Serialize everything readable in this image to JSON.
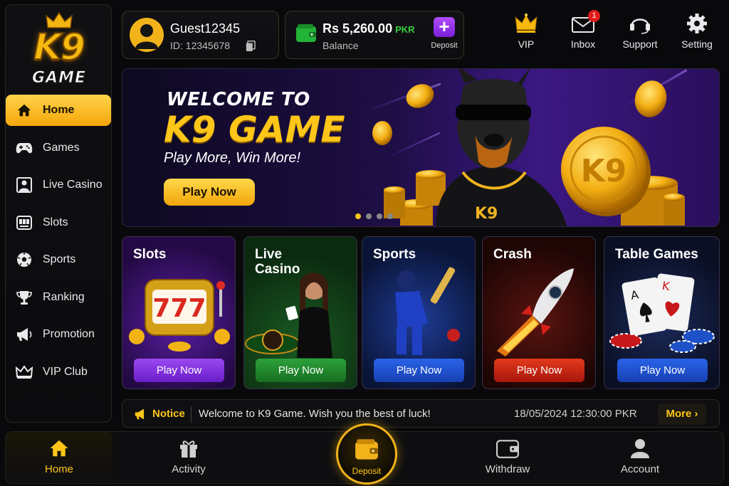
{
  "brand": {
    "logo_top": "K9",
    "logo_bottom": "GAME"
  },
  "sidebar": {
    "items": [
      {
        "label": "Home",
        "icon": "home-icon",
        "active": true
      },
      {
        "label": "Games",
        "icon": "gamepad-icon"
      },
      {
        "label": "Live Casino",
        "icon": "live-casino-icon"
      },
      {
        "label": "Slots",
        "icon": "slot-machine-icon"
      },
      {
        "label": "Sports",
        "icon": "soccer-ball-icon"
      },
      {
        "label": "Ranking",
        "icon": "trophy-icon"
      },
      {
        "label": "Promotion",
        "icon": "megaphone-icon"
      },
      {
        "label": "VIP Club",
        "icon": "crown-icon"
      }
    ]
  },
  "user": {
    "name": "Guest12345",
    "id_text": "ID: 12345678"
  },
  "balance": {
    "amount": "Rs 5,260.00",
    "currency": "PKR",
    "label": "Balance",
    "deposit_label": "Deposit",
    "plus": "+"
  },
  "top_icons": {
    "vip": "VIP",
    "inbox": "Inbox",
    "inbox_badge": "1",
    "support": "Support",
    "setting": "Setting"
  },
  "banner": {
    "line1": "WELCOME TO",
    "line2": "K9 GAME",
    "line3": "Play More, Win More!",
    "cta": "Play Now",
    "mascot_text": "K9",
    "coin_text": "K9",
    "slide_count": 4,
    "active_slide": 1
  },
  "cards": [
    {
      "title": "Slots",
      "button": "Play Now",
      "color": "#7a2bd4"
    },
    {
      "title": "Live\nCasino",
      "button": "Play Now",
      "color": "#1f8a2a"
    },
    {
      "title": "Sports",
      "button": "Play Now",
      "color": "#1d4fd0"
    },
    {
      "title": "Crash",
      "button": "Play Now",
      "color": "#c42414"
    },
    {
      "title": "Table Games",
      "button": "Play Now",
      "color": "#1d4fb8"
    }
  ],
  "notice": {
    "label": "Notice",
    "text": "Welcome to K9 Game. Wish you the best of luck!",
    "timestamp": "18/05/2024 12:30:00 PKR",
    "more": "More"
  },
  "bottom_nav": {
    "home": "Home",
    "activity": "Activity",
    "deposit": "Deposit",
    "withdraw": "Withdraw",
    "account": "Account"
  },
  "colors": {
    "accent": "#ffc61a",
    "purple": "#7a2bd4",
    "green": "#33d33c"
  }
}
